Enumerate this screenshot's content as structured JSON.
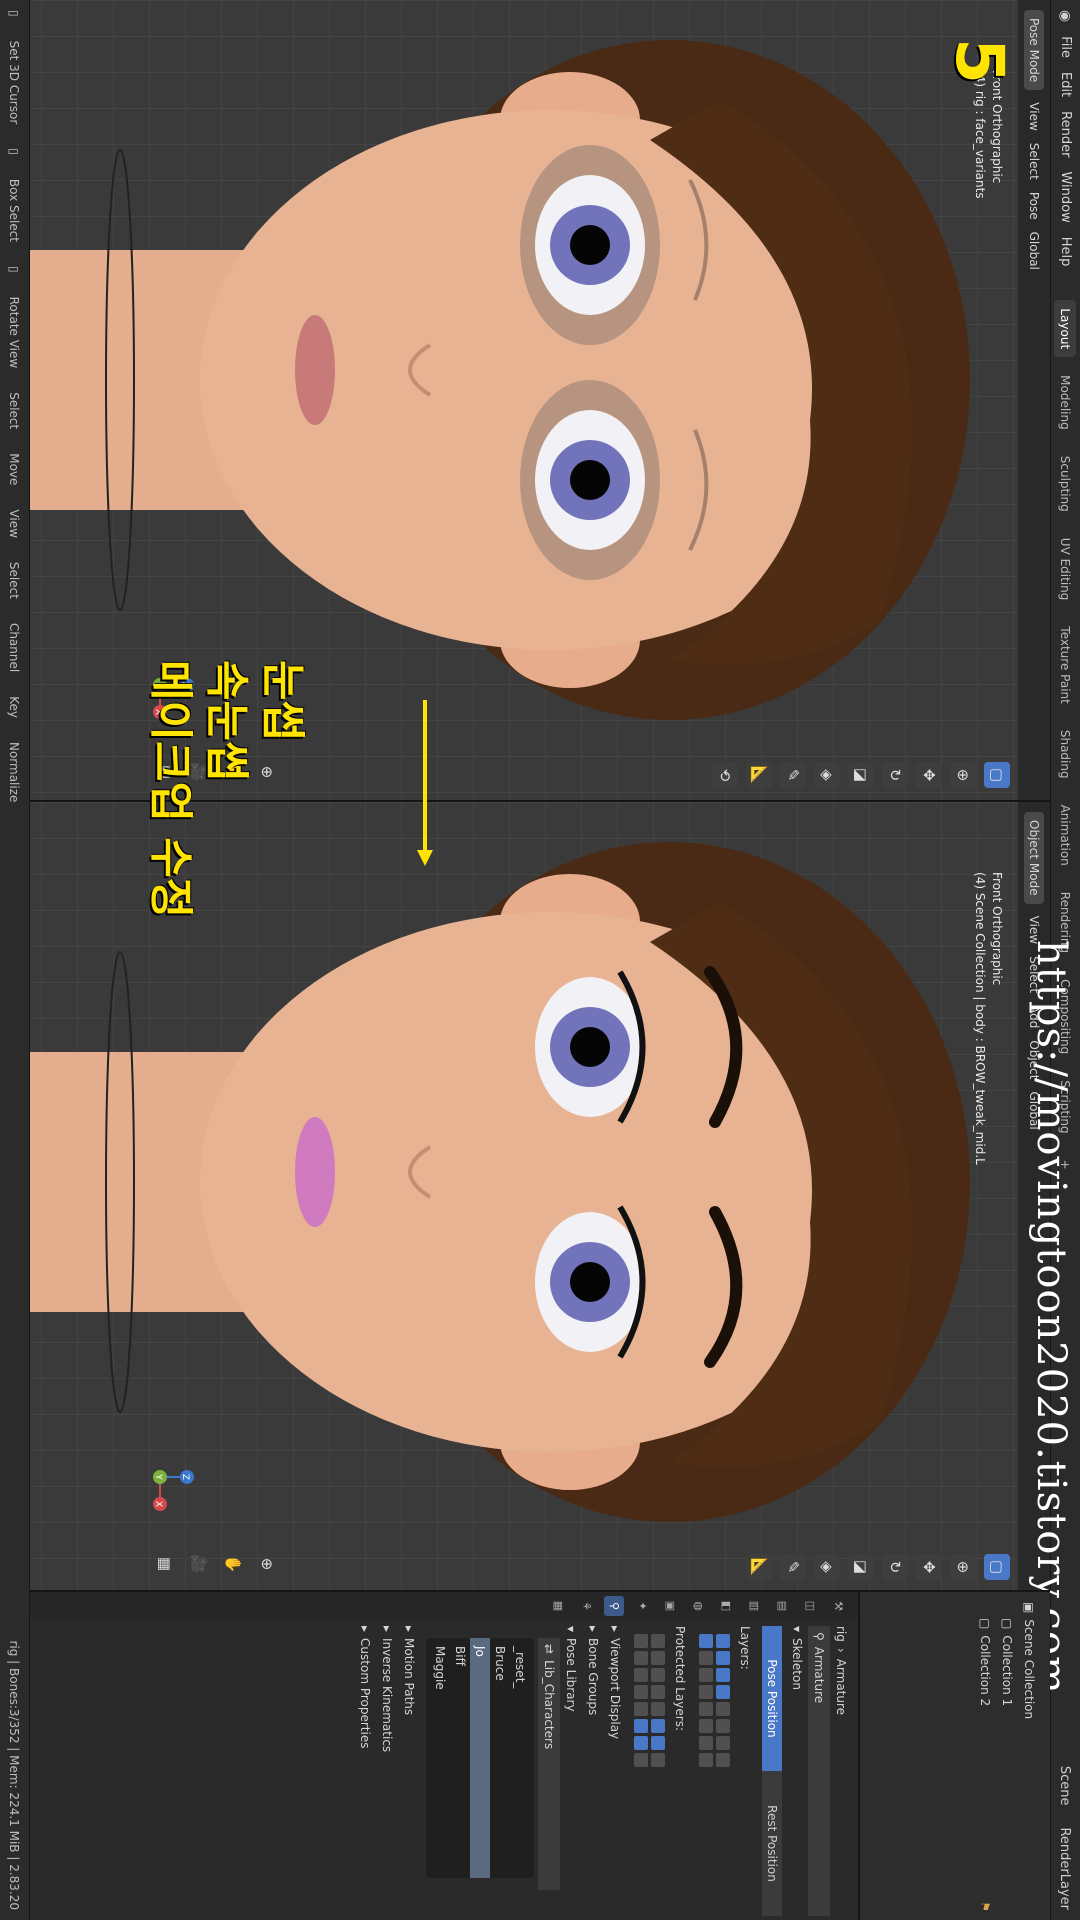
{
  "menu": [
    "File",
    "Edit",
    "Render",
    "Window",
    "Help"
  ],
  "workspaces": [
    "Layout",
    "Modeling",
    "Sculpting",
    "UV Editing",
    "Texture Paint",
    "Shading",
    "Animation",
    "Rendering",
    "Compositing",
    "Scripting"
  ],
  "active_workspace": "Layout",
  "top_right": {
    "scene": "Scene",
    "view_layer": "RenderLayer"
  },
  "left_viewport": {
    "header": {
      "mode": "Pose Mode",
      "view": "View",
      "select": "Select",
      "pose": "Pose",
      "orientation": "Global"
    },
    "info_line1": "Front Orthographic",
    "info_line2": "(4) rig : face_variants"
  },
  "right_viewport": {
    "header": {
      "mode": "Object Mode",
      "view": "View",
      "select": "Select",
      "add": "Add",
      "object": "Object",
      "orientation": "Global"
    },
    "info_line1": "Front Orthographic",
    "info_line2": "(4) Scene Collection | body : BROW_tweak_mid.L"
  },
  "gizmo_axes": {
    "x": "X",
    "y": "Y",
    "z": "Z"
  },
  "overlay": {
    "number": "5",
    "korean_lines": [
      "눈썹",
      "속눈썹",
      "메이크업  수정"
    ],
    "watermark": "https://movingtoon2020.tistory.com"
  },
  "status_bar": {
    "left_items": [
      "Set 3D Cursor",
      "Box Select",
      "Rotate View",
      "Select",
      "Move"
    ],
    "left_menu": [
      "View",
      "Select",
      "Channel",
      "Key",
      "Normalize"
    ],
    "right": "rig | Bones:3/352 | Mem: 224.1 MiB | 2.83.20"
  },
  "outliner": {
    "rows": [
      "Scene Collection",
      "Collection 1",
      "Collection 2"
    ]
  },
  "properties": {
    "breadcrumb": [
      "rig",
      "Armature"
    ],
    "name_field": "Armature",
    "skeleton_panel": "Skeleton",
    "pose_position": "Pose Position",
    "rest_position": "Rest Position",
    "layers_label": "Layers:",
    "protected_layers_label": "Protected Layers:",
    "panels": [
      "Viewport Display",
      "Bone Groups",
      "Pose Library"
    ],
    "library_name": "Lib_Characters",
    "library_items": [
      "_reset_",
      "Bruce",
      "Jo",
      "Biff",
      "Maggie"
    ],
    "selected_item": "Jo",
    "more_panels": [
      "Motion Paths",
      "Inverse Kinematics",
      "Custom Properties"
    ]
  },
  "colors": {
    "accent": "#4a78c8",
    "overlay_text": "#ffe400",
    "skin": "#e8b393",
    "hair": "#4a2a14",
    "iris": "#6e70b8"
  }
}
